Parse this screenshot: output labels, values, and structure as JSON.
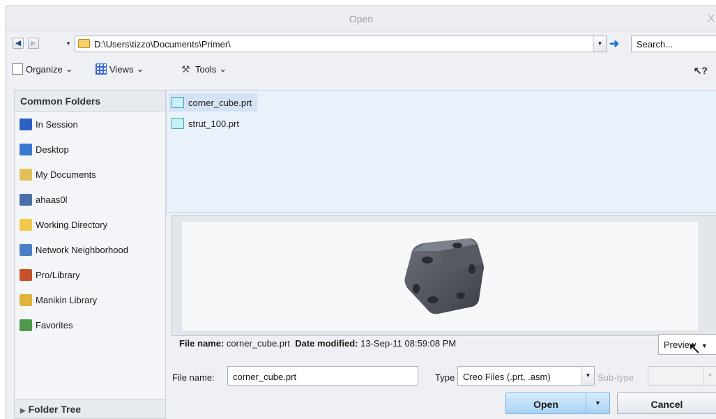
{
  "window": {
    "title": "Open",
    "close_glyph": "X"
  },
  "address": {
    "path": "D:\\Users\\tizzo\\Documents\\Primer\\",
    "search_placeholder": "Search..."
  },
  "toolbar": {
    "organize": "Organize",
    "views": "Views",
    "tools": "Tools"
  },
  "sidebar": {
    "header": "Common Folders",
    "items": [
      {
        "label": "In Session",
        "icon": "in-session-icon",
        "color": "#2e5fc4"
      },
      {
        "label": "Desktop",
        "icon": "desktop-icon",
        "color": "#3a78d0"
      },
      {
        "label": "My Documents",
        "icon": "my-documents-icon",
        "color": "#e3c05a"
      },
      {
        "label": "ahaas0l",
        "icon": "computer-icon",
        "color": "#4b6fa8"
      },
      {
        "label": "Working Directory",
        "icon": "working-directory-icon",
        "color": "#f0c94a"
      },
      {
        "label": "Network Neighborhood",
        "icon": "network-icon",
        "color": "#4a80c8"
      },
      {
        "label": "Pro/Library",
        "icon": "pro-library-icon",
        "color": "#c7512a"
      },
      {
        "label": "Manikin Library",
        "icon": "manikin-library-icon",
        "color": "#e0b43a"
      },
      {
        "label": "Favorites",
        "icon": "favorites-icon",
        "color": "#4f9a4a"
      }
    ],
    "folder_tree": "Folder Tree"
  },
  "files": [
    {
      "name": "corner_cube.prt",
      "selected": true
    },
    {
      "name": "strut_100.prt",
      "selected": false
    }
  ],
  "info": {
    "file_name_label": "File name:",
    "file_name_value": "corner_cube.prt",
    "date_label": "Date modified:",
    "date_value": "13-Sep-11 08:59:08 PM",
    "preview_label": "Preview"
  },
  "form": {
    "file_name_label": "File name:",
    "file_name_value": "corner_cube.prt",
    "type_label": "Type",
    "type_value": "Creo Files (.prt, .asm)",
    "subtype_label": "Sub-type"
  },
  "buttons": {
    "open": "Open",
    "cancel": "Cancel"
  },
  "colors": {
    "selection": "#d4e2f4",
    "open_button": "#a9d3f6",
    "list_bg": "#e9f2fb"
  }
}
